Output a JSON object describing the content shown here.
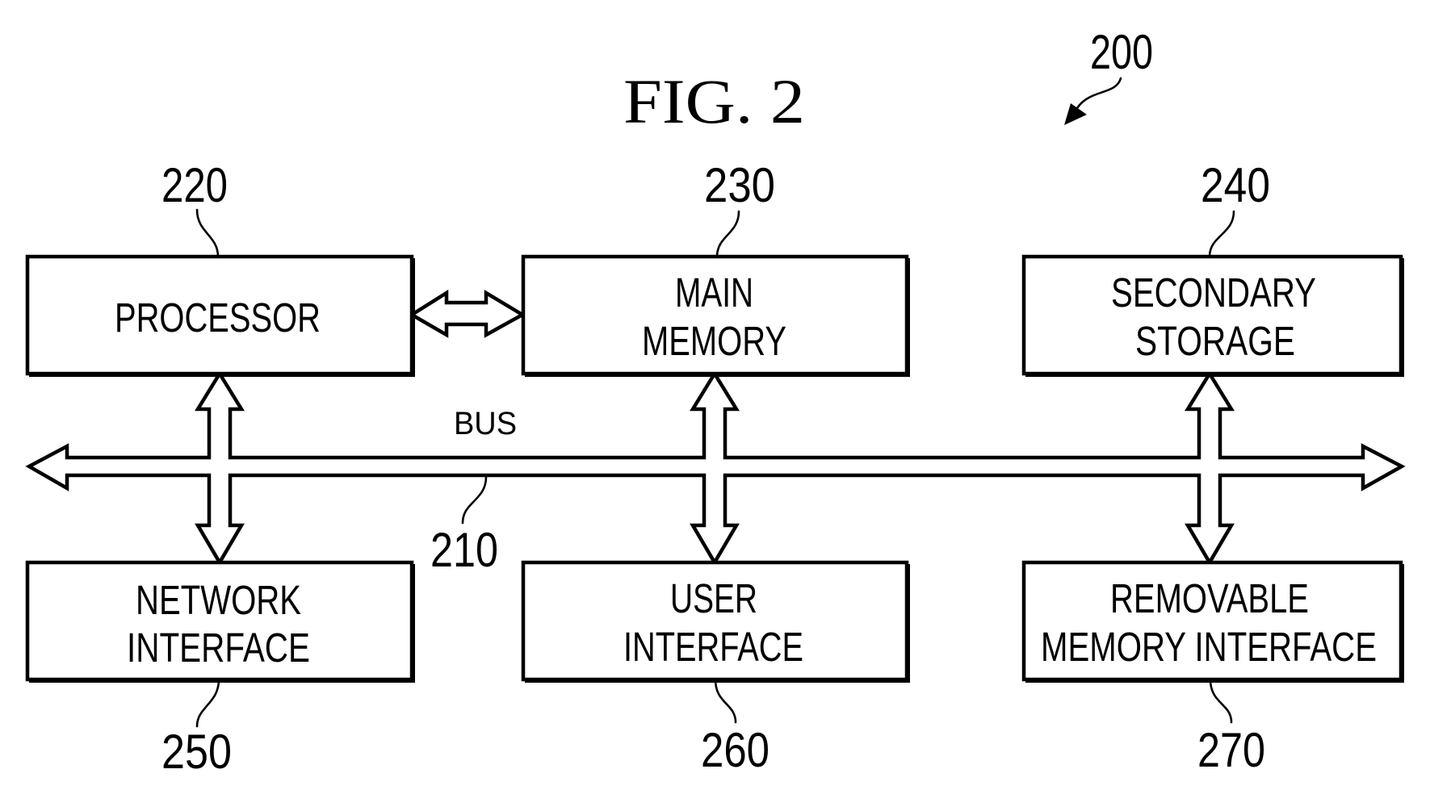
{
  "figure": {
    "title": "FIG. 2",
    "reference": "200",
    "ink_color": "#000000",
    "background_color": "#ffffff"
  },
  "bus": {
    "label": "BUS",
    "reference": "210"
  },
  "components": [
    {
      "id": "processor",
      "reference": "220",
      "lines": [
        "PROCESSOR"
      ]
    },
    {
      "id": "main-memory",
      "reference": "230",
      "lines": [
        "MAIN",
        "MEMORY"
      ]
    },
    {
      "id": "secondary-storage",
      "reference": "240",
      "lines": [
        "SECONDARY",
        "STORAGE"
      ]
    },
    {
      "id": "network-interface",
      "reference": "250",
      "lines": [
        "NETWORK",
        "INTERFACE"
      ]
    },
    {
      "id": "user-interface",
      "reference": "260",
      "lines": [
        "USER",
        "INTERFACE"
      ]
    },
    {
      "id": "removable-memory-interface",
      "reference": "270",
      "lines": [
        "REMOVABLE",
        "MEMORY INTERFACE"
      ]
    }
  ],
  "connections": [
    {
      "from": "processor",
      "to": "main-memory",
      "type": "bidirectional"
    },
    {
      "from": "processor",
      "to": "bus",
      "type": "bidirectional"
    },
    {
      "from": "main-memory",
      "to": "bus",
      "type": "bidirectional"
    },
    {
      "from": "secondary-storage",
      "to": "bus",
      "type": "bidirectional"
    },
    {
      "from": "bus",
      "to": "network-interface",
      "type": "bidirectional"
    },
    {
      "from": "bus",
      "to": "user-interface",
      "type": "bidirectional"
    },
    {
      "from": "bus",
      "to": "removable-memory-interface",
      "type": "bidirectional"
    }
  ]
}
